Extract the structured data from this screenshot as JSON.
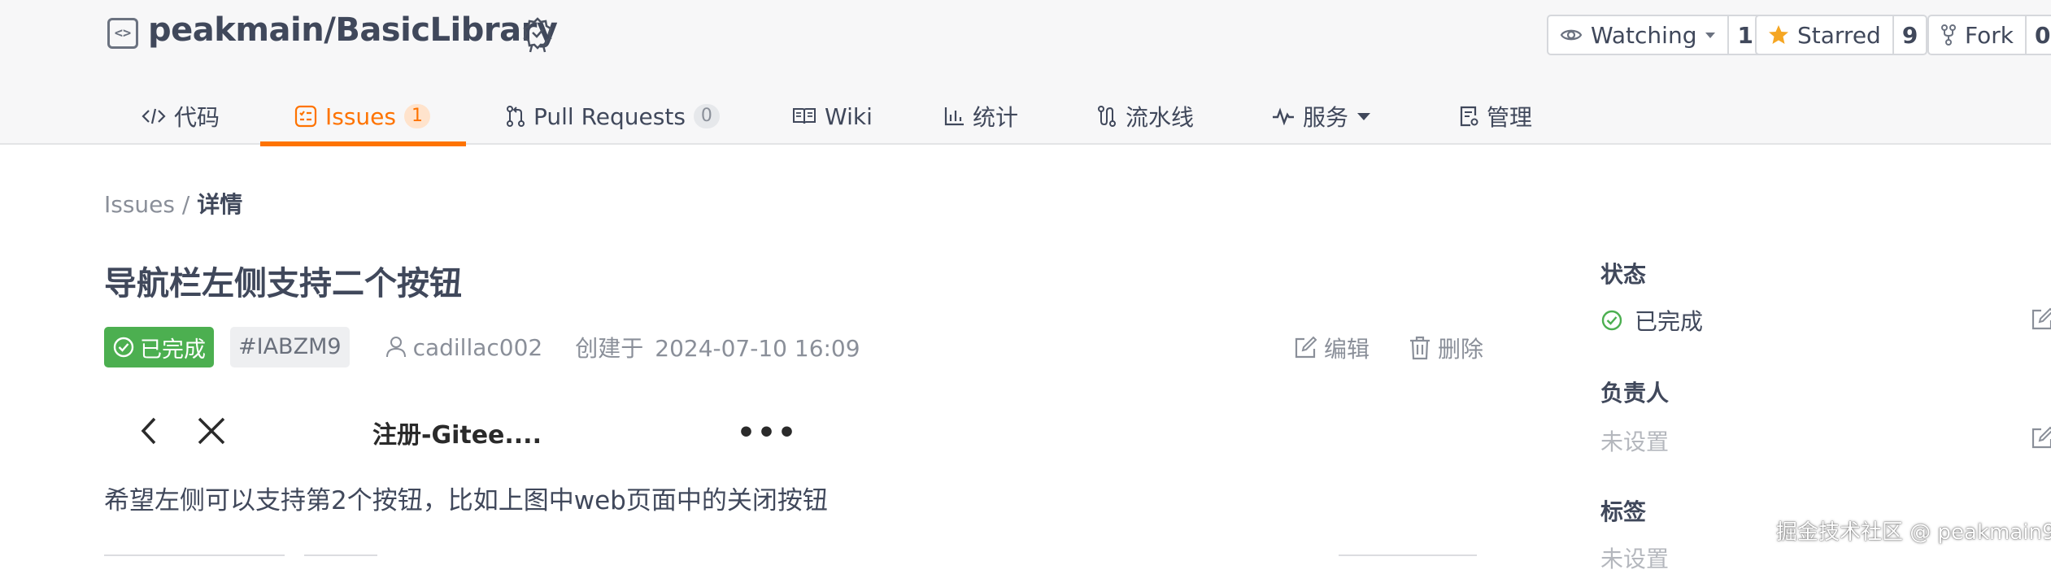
{
  "repo": {
    "name": "peakmain/BasicLibrary"
  },
  "social": {
    "watch_label": "Watching",
    "watch_count": "1",
    "star_label": "Starred",
    "star_count": "9",
    "fork_label": "Fork",
    "fork_count": "0"
  },
  "tabs": [
    {
      "label": "代码",
      "icon": "code-icon"
    },
    {
      "label": "Issues",
      "badge": "1",
      "icon": "issues-icon"
    },
    {
      "label": "Pull Requests",
      "badge": "0",
      "icon": "pull-request-icon"
    },
    {
      "label": "Wiki",
      "icon": "book-icon"
    },
    {
      "label": "统计",
      "icon": "bar-chart-icon"
    },
    {
      "label": "流水线",
      "icon": "pipeline-icon"
    },
    {
      "label": "服务",
      "icon": "activity-icon"
    },
    {
      "label": "管理",
      "icon": "settings-doc-icon"
    }
  ],
  "breadcrumb": {
    "root": "Issues",
    "separator": "/",
    "current": "详情"
  },
  "issue": {
    "title": "导航栏左侧支持二个按钮",
    "status": "已完成",
    "id": "#IABZM9",
    "author": "cadillac002",
    "created_label": "创建于",
    "created_at": "2024-07-10 16:09",
    "edit_label": "编辑",
    "delete_label": "删除",
    "embedded_title": "注册-Gitee....",
    "embedded_more": "•••",
    "description": "希望左侧可以支持第2个按钮，比如上图中web页面中的关闭按钮"
  },
  "sidebar": {
    "status_label": "状态",
    "status_value": "已完成",
    "assignee_label": "负责人",
    "assignee_value": "未设置",
    "tags_label": "标签",
    "tags_value": "未设置"
  },
  "watermark": "掘金技术社区 @ peakmain9",
  "colors": {
    "accent": "#fe7300",
    "success": "#4caf50",
    "text": "#40485b",
    "muted": "#8a8f99"
  }
}
